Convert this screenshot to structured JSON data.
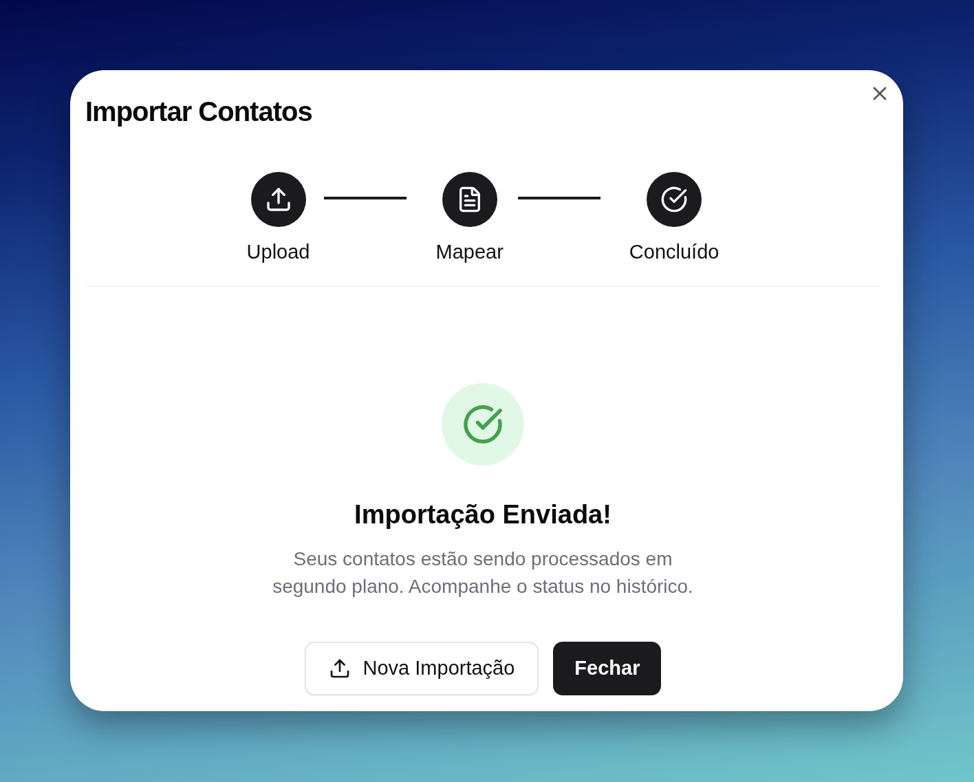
{
  "dialog": {
    "title": "Importar Contatos"
  },
  "steps": [
    {
      "kind": "upload",
      "label": "Upload",
      "done": true
    },
    {
      "kind": "map",
      "label": "Mapear",
      "done": true
    },
    {
      "kind": "complete",
      "label": "Concluído",
      "done": true
    }
  ],
  "result": {
    "heading": "Importação Enviada!",
    "message": "Seus contatos estão sendo processados em segundo plano. Acompanhe o status no histórico."
  },
  "buttons": [
    {
      "kind": "secondary",
      "label": "Nova Importação"
    },
    {
      "kind": "primary",
      "label": "Fechar"
    }
  ]
}
